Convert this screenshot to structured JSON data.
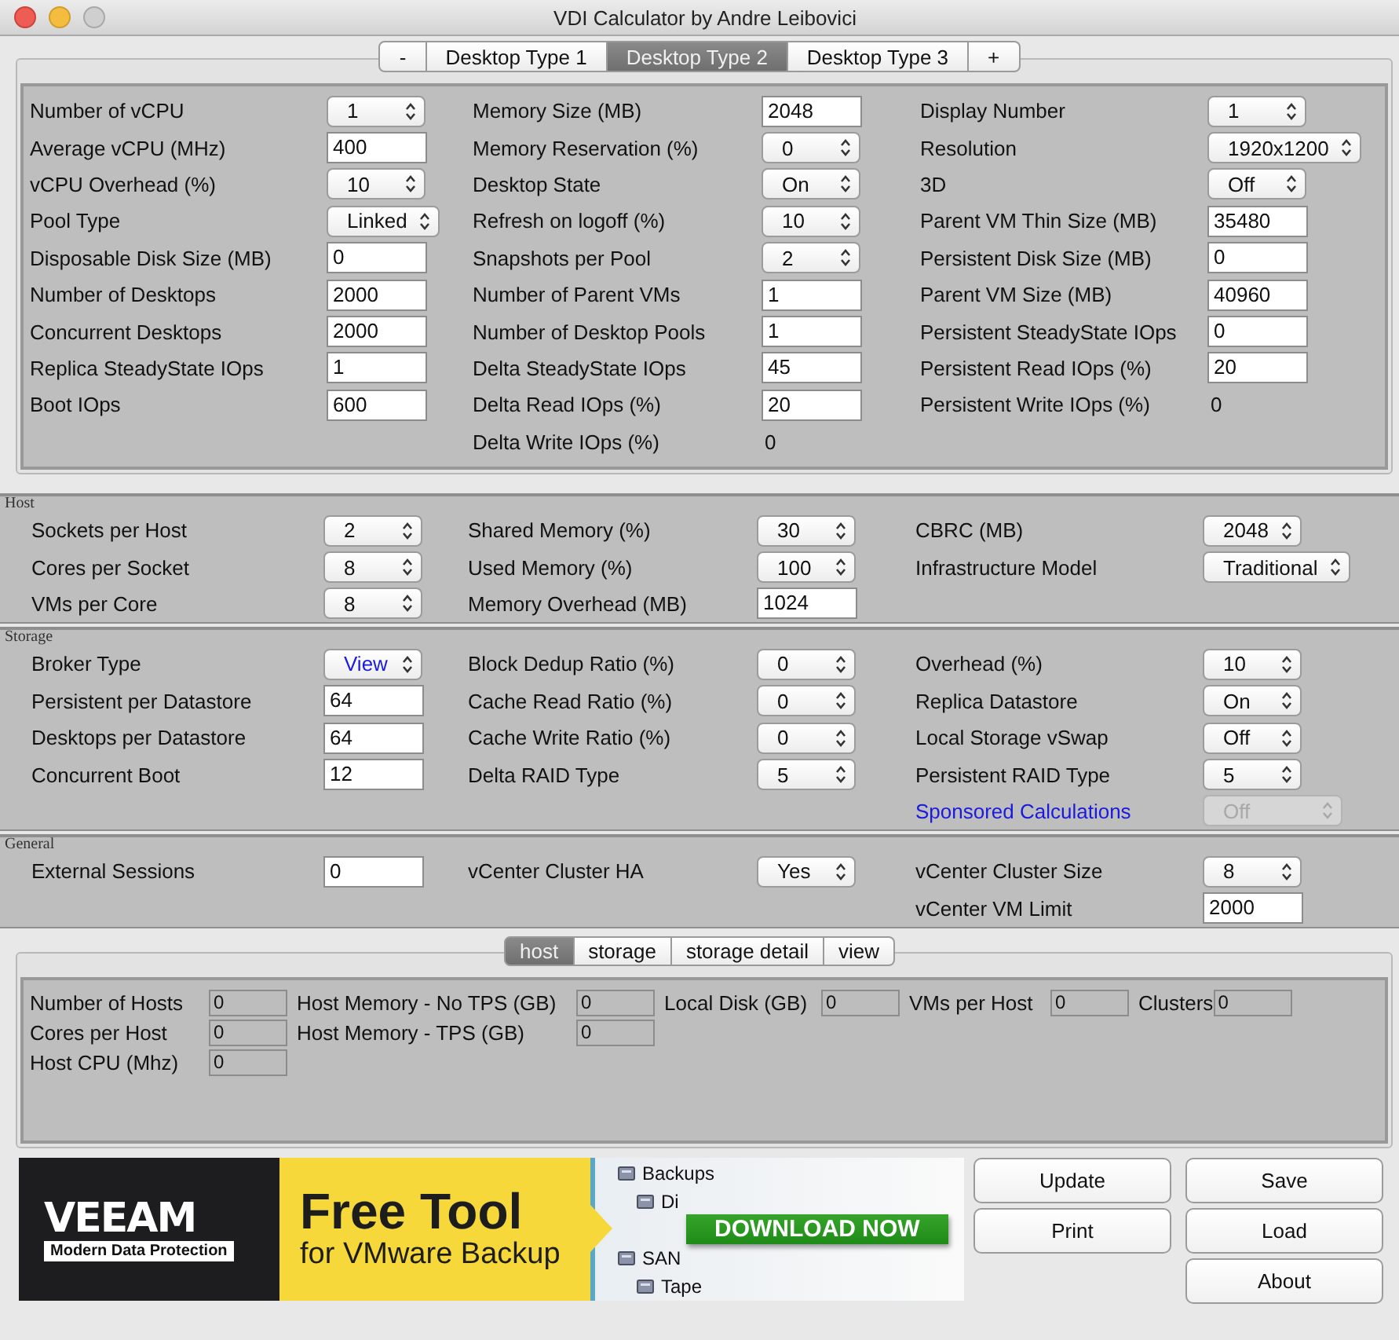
{
  "window": {
    "title": "VDI Calculator by Andre Leibovici"
  },
  "desktop_tabs": [
    {
      "label": "-",
      "selected": false
    },
    {
      "label": "Desktop Type 1",
      "selected": false
    },
    {
      "label": "Desktop Type 2",
      "selected": true
    },
    {
      "label": "Desktop Type 3",
      "selected": false
    },
    {
      "label": "+",
      "selected": false
    }
  ],
  "desktop_type": {
    "columns": [
      [
        {
          "label": "Number of vCPU",
          "kind": "spinner",
          "value": "1"
        },
        {
          "label": "Average vCPU (MHz)",
          "kind": "input",
          "value": "400"
        },
        {
          "label": "vCPU Overhead (%)",
          "kind": "spinner",
          "value": "10"
        },
        {
          "label": "Pool Type",
          "kind": "spinner",
          "value": "Linked"
        },
        {
          "label": "Disposable Disk Size (MB)",
          "kind": "input",
          "value": "0"
        },
        {
          "label": "Number of Desktops",
          "kind": "input",
          "value": "2000"
        },
        {
          "label": "Concurrent Desktops",
          "kind": "input",
          "value": "2000"
        },
        {
          "label": "Replica SteadyState IOps",
          "kind": "input",
          "value": "1"
        },
        {
          "label": "Boot IOps",
          "kind": "input",
          "value": "600"
        }
      ],
      [
        {
          "label": "Memory Size (MB)",
          "kind": "input",
          "value": "2048"
        },
        {
          "label": "Memory Reservation (%)",
          "kind": "spinner",
          "value": "0"
        },
        {
          "label": "Desktop State",
          "kind": "spinner",
          "value": "On"
        },
        {
          "label": "Refresh on logoff (%)",
          "kind": "spinner",
          "value": "10"
        },
        {
          "label": "Snapshots per Pool",
          "kind": "spinner",
          "value": "2"
        },
        {
          "label": "Number of Parent VMs",
          "kind": "input",
          "value": "1"
        },
        {
          "label": "Number of Desktop Pools",
          "kind": "input",
          "value": "1"
        },
        {
          "label": "Delta SteadyState IOps",
          "kind": "input",
          "value": "45"
        },
        {
          "label": "Delta Read IOps (%)",
          "kind": "input",
          "value": "20"
        },
        {
          "label": "Delta Write IOps (%)",
          "kind": "readout",
          "value": "0"
        }
      ],
      [
        {
          "label": "Display Number",
          "kind": "spinner",
          "value": "1"
        },
        {
          "label": "Resolution",
          "kind": "spinner",
          "value": "1920x1200"
        },
        {
          "label": "3D",
          "kind": "spinner",
          "value": "Off"
        },
        {
          "label": "Parent VM Thin Size (MB)",
          "kind": "input",
          "value": "35480"
        },
        {
          "label": "Persistent Disk Size (MB)",
          "kind": "input",
          "value": "0"
        },
        {
          "label": "Parent VM Size (MB)",
          "kind": "input",
          "value": "40960"
        },
        {
          "label": "Persistent SteadyState IOps",
          "kind": "input",
          "value": "0"
        },
        {
          "label": "Persistent Read IOps (%)",
          "kind": "input",
          "value": "20"
        },
        {
          "label": "Persistent Write IOps (%)",
          "kind": "readout",
          "value": "0"
        }
      ]
    ]
  },
  "sections": [
    {
      "title": "Host",
      "columns": [
        [
          {
            "label": "Sockets per Host",
            "kind": "spinner",
            "value": "2"
          },
          {
            "label": "Cores per Socket",
            "kind": "spinner",
            "value": "8"
          },
          {
            "label": "VMs per Core",
            "kind": "spinner",
            "value": "8"
          }
        ],
        [
          {
            "label": "Shared Memory (%)",
            "kind": "spinner",
            "value": "30"
          },
          {
            "label": "Used Memory (%)",
            "kind": "spinner",
            "value": "100"
          },
          {
            "label": "Memory Overhead (MB)",
            "kind": "input",
            "value": "1024"
          }
        ],
        [
          {
            "label": "CBRC (MB)",
            "kind": "spinner",
            "value": "2048"
          },
          {
            "label": "Infrastructure Model",
            "kind": "spinner",
            "value": "Traditional"
          }
        ]
      ]
    },
    {
      "title": "Storage",
      "columns": [
        [
          {
            "label": "Broker Type",
            "kind": "spinner",
            "value": "View",
            "accent": true
          },
          {
            "label": "Persistent per Datastore",
            "kind": "input",
            "value": "64"
          },
          {
            "label": "Desktops per Datastore",
            "kind": "input",
            "value": "64"
          },
          {
            "label": "Concurrent Boot",
            "kind": "input",
            "value": "12"
          }
        ],
        [
          {
            "label": "Block Dedup Ratio (%)",
            "kind": "spinner",
            "value": "0"
          },
          {
            "label": "Cache Read Ratio (%)",
            "kind": "spinner",
            "value": "0"
          },
          {
            "label": "Cache Write Ratio (%)",
            "kind": "spinner",
            "value": "0"
          },
          {
            "label": "Delta RAID Type",
            "kind": "spinner",
            "value": "5"
          }
        ],
        [
          {
            "label": "Overhead (%)",
            "kind": "spinner",
            "value": "10"
          },
          {
            "label": "Replica Datastore",
            "kind": "spinner",
            "value": "On"
          },
          {
            "label": "Local Storage vSwap",
            "kind": "spinner",
            "value": "Off"
          },
          {
            "label": "Persistent RAID Type",
            "kind": "spinner",
            "value": "5"
          },
          {
            "label": "Sponsored Calculations",
            "kind": "spinner",
            "value": "Off",
            "link": true,
            "disabled": true
          }
        ]
      ]
    },
    {
      "title": "General",
      "columns": [
        [
          {
            "label": "External Sessions",
            "kind": "input",
            "value": "0"
          }
        ],
        [
          {
            "label": "vCenter Cluster HA",
            "kind": "spinner",
            "value": "Yes"
          }
        ],
        [
          {
            "label": "vCenter Cluster Size",
            "kind": "spinner",
            "value": "8"
          },
          {
            "label": "vCenter VM Limit",
            "kind": "input",
            "value": "2000"
          }
        ]
      ]
    }
  ],
  "result_tabs": [
    {
      "label": "host",
      "selected": true
    },
    {
      "label": "storage",
      "selected": false
    },
    {
      "label": "storage detail",
      "selected": false
    },
    {
      "label": "view",
      "selected": false
    }
  ],
  "results": {
    "rows": [
      [
        {
          "label": "Number of Hosts",
          "value": "0"
        },
        {
          "label": "Host Memory - No TPS (GB)",
          "value": "0"
        },
        {
          "label": "Local Disk (GB)",
          "value": "0"
        },
        {
          "label": "VMs per Host",
          "value": "0"
        },
        {
          "label": "Clusters",
          "value": "0"
        }
      ],
      [
        {
          "label": "Cores per Host",
          "value": "0"
        },
        {
          "label": "Host Memory - TPS (GB)",
          "value": "0"
        }
      ],
      [
        {
          "label": "Host CPU (Mhz)",
          "value": "0"
        }
      ]
    ]
  },
  "ad": {
    "logo": "VEEAM",
    "tagline": "Modern Data Protection",
    "headline": "Free Tool",
    "subheadline": "for VMware Backup",
    "cta": "DOWNLOAD NOW",
    "tree": [
      "Backups",
      "Di",
      "SAN",
      "Tape"
    ]
  },
  "button_columns": [
    [
      "Update",
      "Print"
    ],
    [
      "Save",
      "Load",
      "About"
    ]
  ]
}
